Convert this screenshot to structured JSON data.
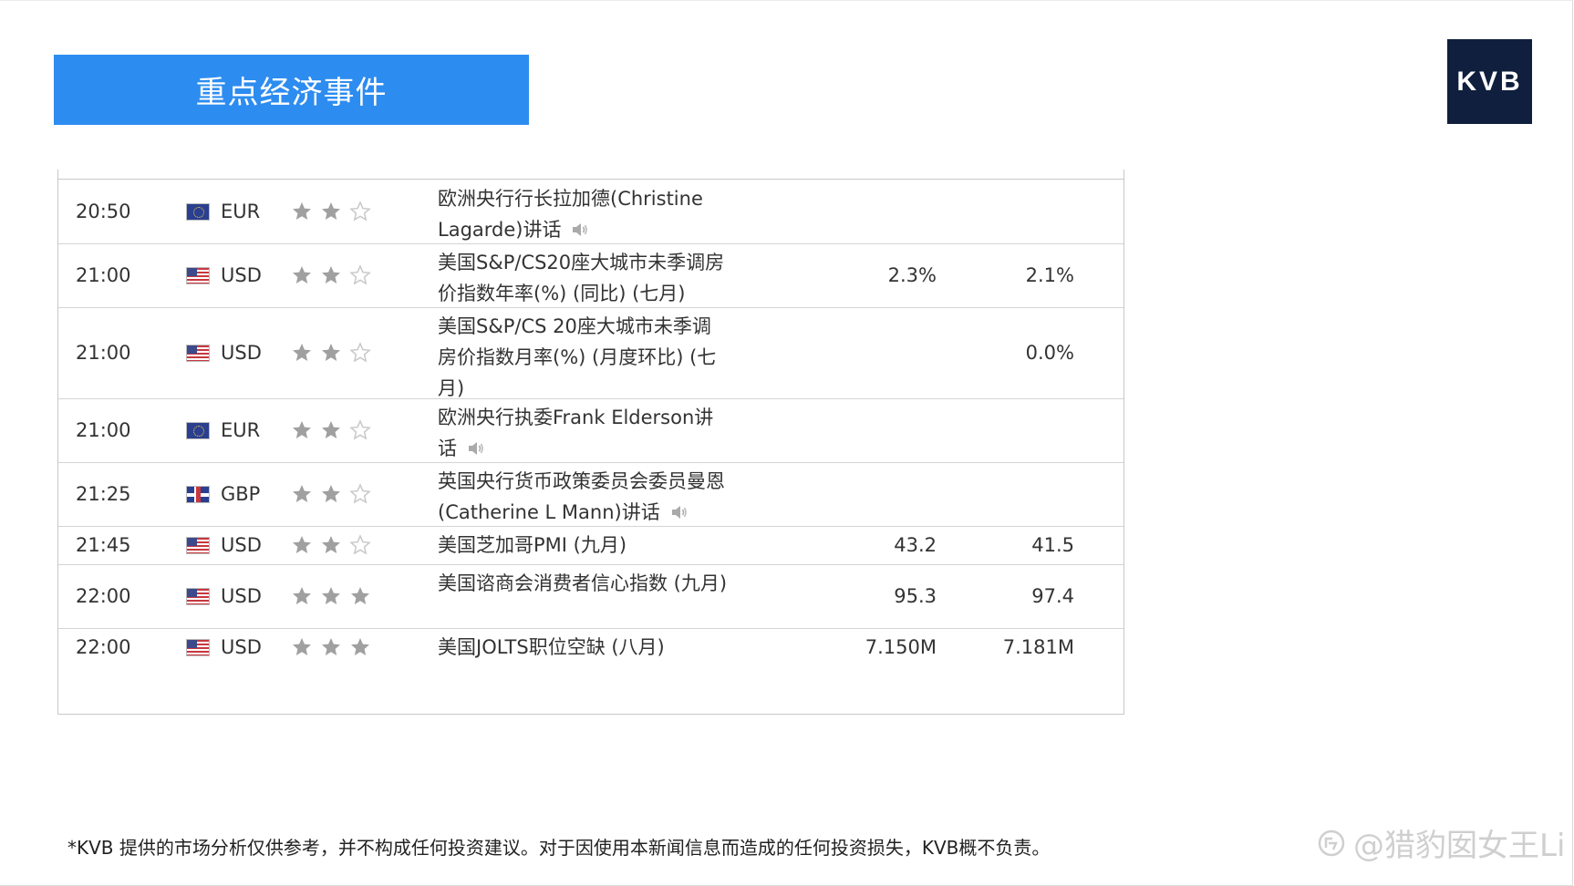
{
  "slide": {
    "title": "重点经济事件",
    "logo": "KVB",
    "disclaimer": "*KVB 提供的市场分析仅供参考，并不构成任何投资建议。对于因使用本新闻信息而造成的任何投资损失，KVB概不负责。",
    "watermark": "@猎豹囡女王Li"
  },
  "colors": {
    "banner": "#2d8cf0",
    "logo_bg": "#0f1f3d",
    "star_filled": "#a0a0a0",
    "star_empty": "#c8c8c8"
  },
  "events": [
    {
      "time": "20:50",
      "flag": "eu-flag-icon",
      "currency": "EUR",
      "importance": 2,
      "event": "欧洲央行行长拉加德(Christine Lagarde)讲话",
      "speech": true,
      "previous": "",
      "forecast": ""
    },
    {
      "time": "21:00",
      "flag": "us-flag-icon",
      "currency": "USD",
      "importance": 2,
      "event": "美国S&P/CS20座大城市未季调房价指数年率(%) (同比) (七月)",
      "speech": false,
      "previous": "2.3%",
      "forecast": "2.1%"
    },
    {
      "time": "21:00",
      "flag": "us-flag-icon",
      "currency": "USD",
      "importance": 2,
      "event": "美国S&P/CS 20座大城市未季调房价指数月率(%) (月度环比) (七月)",
      "speech": false,
      "previous": "",
      "forecast": "0.0%"
    },
    {
      "time": "21:00",
      "flag": "eu-flag-icon",
      "currency": "EUR",
      "importance": 2,
      "event": "欧洲央行执委Frank Elderson讲话",
      "speech": true,
      "previous": "",
      "forecast": ""
    },
    {
      "time": "21:25",
      "flag": "gb-flag-icon",
      "currency": "GBP",
      "importance": 2,
      "event": "英国央行货币政策委员会委员曼恩(Catherine L Mann)讲话",
      "speech": true,
      "previous": "",
      "forecast": ""
    },
    {
      "time": "21:45",
      "flag": "us-flag-icon",
      "currency": "USD",
      "importance": 2,
      "event": "美国芝加哥PMI (九月)",
      "speech": false,
      "previous": "43.2",
      "forecast": "41.5"
    },
    {
      "time": "22:00",
      "flag": "us-flag-icon",
      "currency": "USD",
      "importance": 3,
      "event": "美国谘商会消费者信心指数 (九月)",
      "speech": false,
      "previous": "95.3",
      "forecast": "97.4"
    },
    {
      "time": "22:00",
      "flag": "us-flag-icon",
      "currency": "USD",
      "importance": 3,
      "event": "美国JOLTS职位空缺 (八月)",
      "speech": false,
      "previous": "7.150M",
      "forecast": "7.181M"
    }
  ]
}
